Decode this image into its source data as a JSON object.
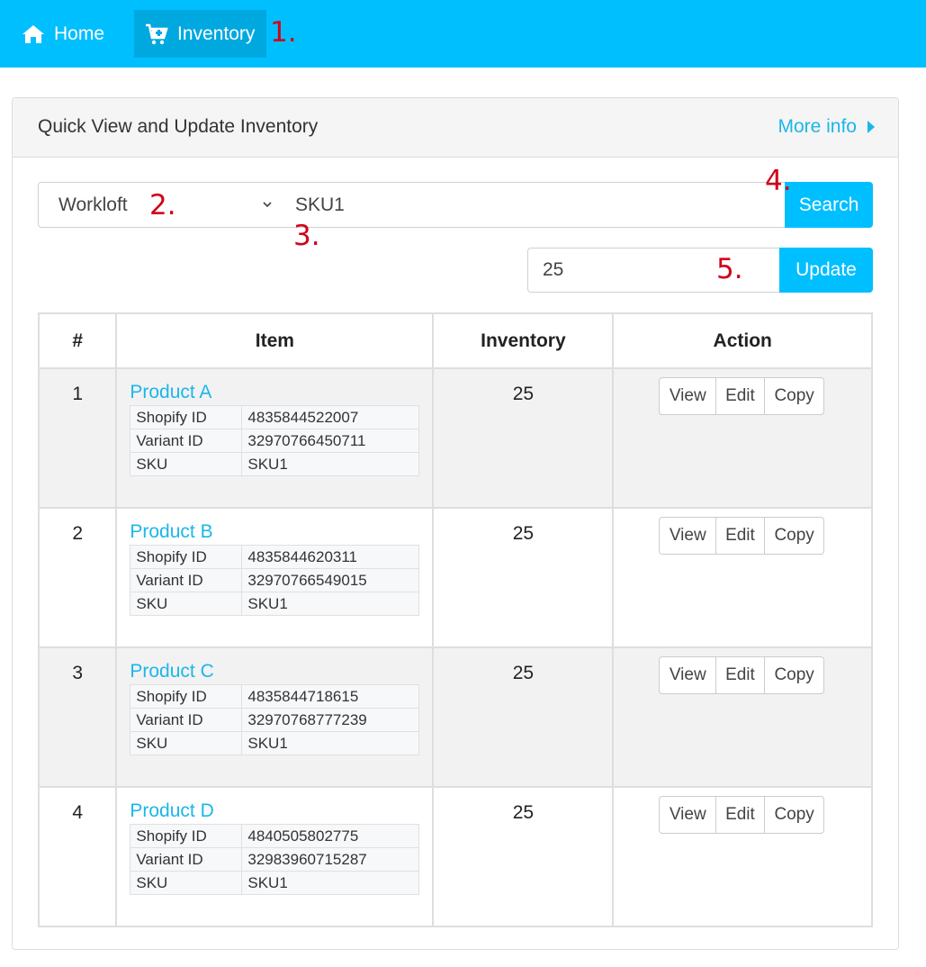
{
  "nav": {
    "home_label": "Home",
    "inventory_label": "Inventory"
  },
  "annotations": [
    "1.",
    "2.",
    "3.",
    "4.",
    "5."
  ],
  "card": {
    "title": "Quick View and Update Inventory",
    "more_info": "More info"
  },
  "search": {
    "store_value": "Workloft",
    "sku_value": "SKU1",
    "button_label": "Search"
  },
  "update": {
    "qty_value": "25",
    "button_label": "Update"
  },
  "table": {
    "headers": [
      "#",
      "Item",
      "Inventory",
      "Action"
    ],
    "meta_labels": [
      "Shopify ID",
      "Variant ID",
      "SKU"
    ],
    "action_labels": [
      "View",
      "Edit",
      "Copy"
    ],
    "rows": [
      {
        "num": "1",
        "product": "Product A",
        "shopify_id": "4835844522007",
        "variant_id": "32970766450711",
        "sku": "SKU1",
        "inventory": "25"
      },
      {
        "num": "2",
        "product": "Product B",
        "shopify_id": "4835844620311",
        "variant_id": "32970766549015",
        "sku": "SKU1",
        "inventory": "25"
      },
      {
        "num": "3",
        "product": "Product C",
        "shopify_id": "4835844718615",
        "variant_id": "32970768777239",
        "sku": "SKU1",
        "inventory": "25"
      },
      {
        "num": "4",
        "product": "Product D",
        "shopify_id": "4840505802775",
        "variant_id": "32983960715287",
        "sku": "SKU1",
        "inventory": "25"
      }
    ]
  },
  "colors": {
    "primary": "#00bfff",
    "nav_active": "#00a8e0",
    "link": "#1ab7ea",
    "annotation": "#d0021b",
    "stripe": "#f2f2f2"
  },
  "icons": {
    "home": "home-icon",
    "inventory": "cart-plus-icon",
    "more_info": "caret-right-icon",
    "select": "chevron-down-icon"
  }
}
